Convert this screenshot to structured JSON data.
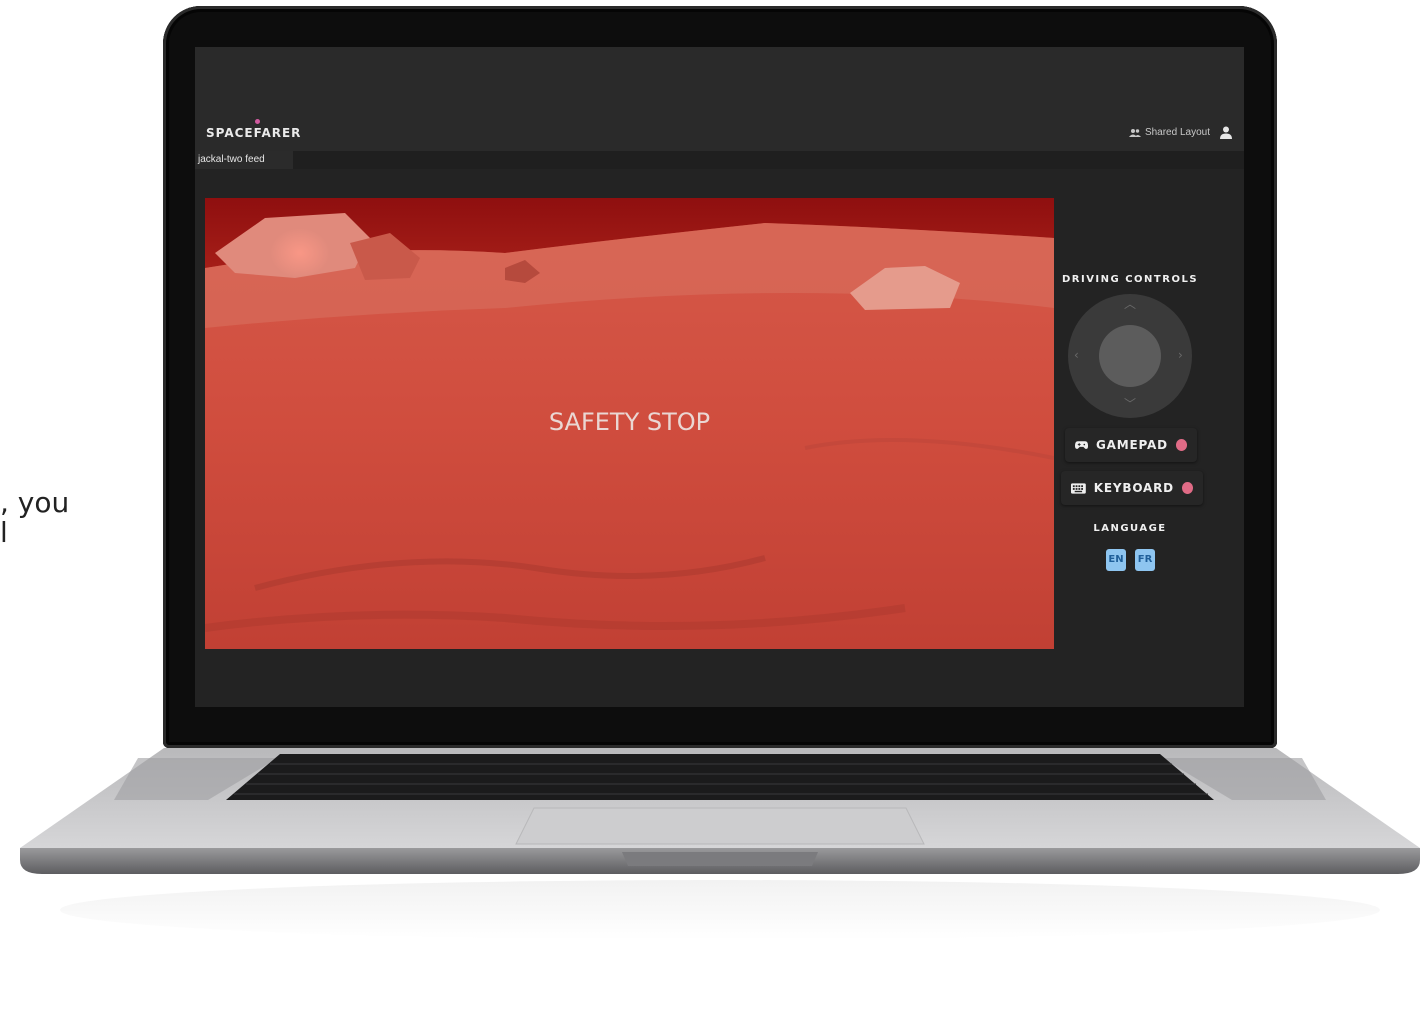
{
  "background_text": ", you\nl",
  "app": {
    "logo_text": "SPACEFARER",
    "shared_layout_label": "Shared Layout",
    "tab_label": "jackal-two feed"
  },
  "feed": {
    "overlay_text": "SAFETY STOP",
    "tint_color": "#c0392b"
  },
  "driving": {
    "title": "DRIVING CONTROLS",
    "gamepad_label": "GAMEPAD",
    "keyboard_label": "KEYBOARD",
    "status_color": "#e06b86"
  },
  "language": {
    "title": "LANGUAGE",
    "options": [
      "EN",
      "FR"
    ]
  },
  "icons": [
    "team-icon",
    "user-icon",
    "gamepad-icon",
    "keyboard-icon",
    "chevron-up-icon",
    "chevron-down-icon",
    "chevron-left-icon",
    "chevron-right-icon"
  ]
}
